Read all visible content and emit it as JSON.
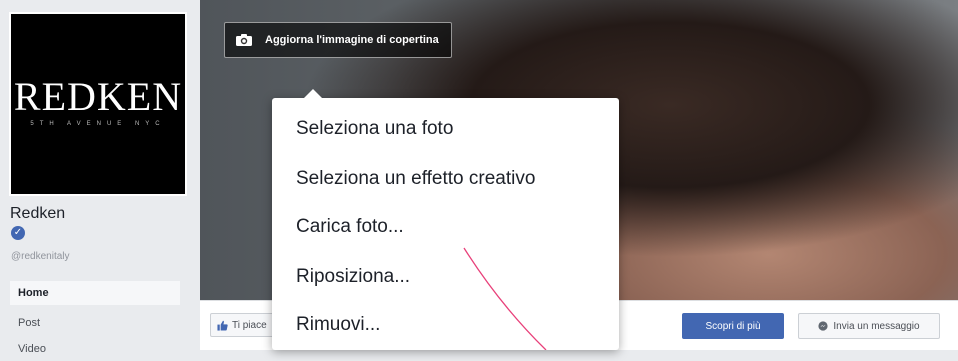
{
  "profile": {
    "logo_text": "REDKEN",
    "logo_tagline": "5TH AVENUE NYC",
    "page_name": "Redken",
    "verified_symbol": "✓",
    "handle": "@redkenitaly"
  },
  "nav": {
    "items": [
      {
        "label": "Home",
        "active": true
      },
      {
        "label": "Post",
        "active": false
      },
      {
        "label": "Video",
        "active": false
      }
    ]
  },
  "cover": {
    "update_button_label": "Aggiorna l'immagine di copertina",
    "update_button_icon": "camera-icon"
  },
  "menu": {
    "items": [
      {
        "label": "Seleziona una foto"
      },
      {
        "label": "Seleziona un effetto creativo"
      },
      {
        "label": "Carica foto..."
      },
      {
        "label": "Riposiziona..."
      },
      {
        "label": "Rimuovi..."
      }
    ]
  },
  "action_bar": {
    "like_label": "Ti piace",
    "like_icon": "thumbs-up-icon",
    "learn_more_label": "Scopri di più",
    "message_label": "Invia un messaggio",
    "message_icon": "messenger-icon"
  },
  "colors": {
    "brand_blue": "#4267b2",
    "annotation_pink": "#e8407a"
  }
}
